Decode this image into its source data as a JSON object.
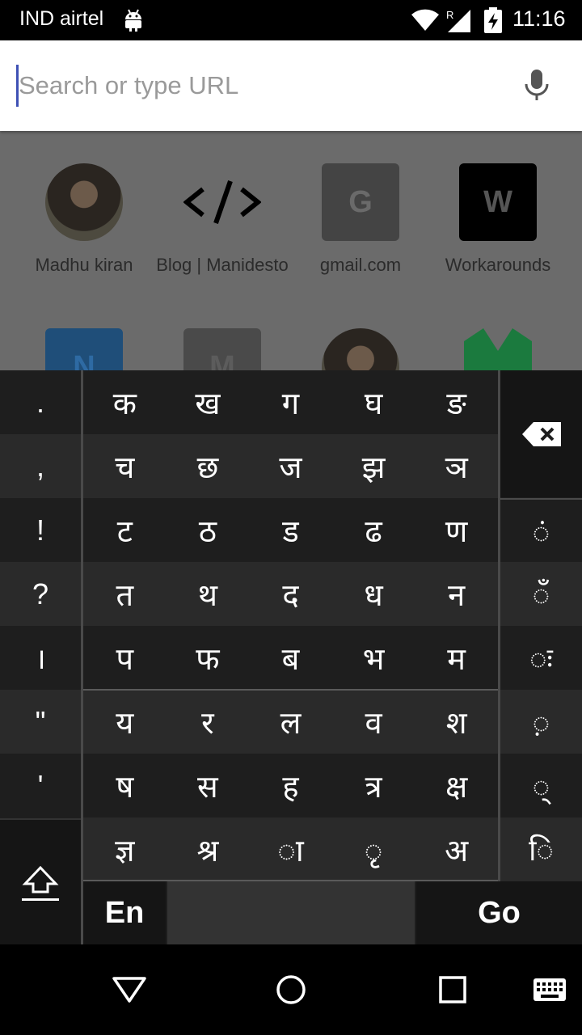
{
  "status_bar": {
    "carrier": "IND airtel",
    "time": "11:16",
    "signal_badge": "R",
    "icons": [
      "android-icon",
      "wifi-icon",
      "signal-icon",
      "battery-charging-icon"
    ]
  },
  "url_bar": {
    "placeholder": "Search or type URL",
    "value": "",
    "mic_icon": "mic-icon"
  },
  "tiles": [
    {
      "label": "Madhu kiran",
      "type": "avatar"
    },
    {
      "label": "Blog | Manidesto",
      "type": "code-logo",
      "glyph": "</>"
    },
    {
      "label": "gmail.com",
      "type": "letter",
      "letter": "G"
    },
    {
      "label": "Workarounds",
      "type": "letter",
      "letter": "W"
    },
    {
      "label": "",
      "type": "letter",
      "letter": "N"
    },
    {
      "label": "",
      "type": "letter",
      "letter": "M"
    },
    {
      "label": "",
      "type": "avatar"
    },
    {
      "label": "",
      "type": "green-logo"
    }
  ],
  "keyboard": {
    "punctuation": [
      ".",
      ",",
      "!",
      "?",
      "।",
      "\"",
      "'"
    ],
    "rows": [
      [
        "क",
        "ख",
        "ग",
        "घ",
        "ङ"
      ],
      [
        "च",
        "छ",
        "ज",
        "झ",
        "ञ"
      ],
      [
        "ट",
        "ठ",
        "ड",
        "ढ",
        "ण"
      ],
      [
        "त",
        "थ",
        "द",
        "ध",
        "न"
      ],
      [
        "प",
        "फ",
        "ब",
        "भ",
        "म"
      ],
      [
        "य",
        "र",
        "ल",
        "व",
        "श"
      ],
      [
        "ष",
        "स",
        "ह",
        "त्र",
        "क्ष"
      ],
      [
        "ज्ञ",
        "श्र",
        "◌ा",
        "◌ृ",
        "अ"
      ]
    ],
    "matras": [
      "◌ं",
      "◌ँ",
      "◌ः",
      "◌़",
      "◌्",
      "◌ि"
    ],
    "lang_key": "En",
    "action_key": "Go",
    "icons": [
      "backspace-icon",
      "shift-icon"
    ]
  },
  "nav_bar": {
    "icons": [
      "back-icon",
      "home-icon",
      "recents-icon",
      "keyboard-icon"
    ]
  }
}
